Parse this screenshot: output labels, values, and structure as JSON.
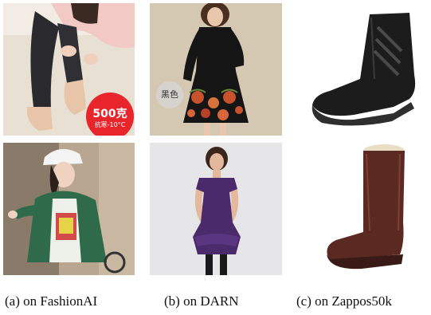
{
  "images": {
    "leggings": {
      "badge_weight": "500克",
      "badge_note": "抗寒-10°C"
    },
    "dress_black": {
      "badge_color": "黑色"
    }
  },
  "captions": {
    "a": "(a) on FashionAI",
    "b": "(b) on DARN",
    "c": "(c) on Zappos50k"
  },
  "colors": {
    "badge_red": "#e8252b",
    "leggings_black": "#2a2a2e",
    "dress_black": "#151515",
    "dress_purple": "#4a2a6a",
    "boot_black": "#1c1c1c",
    "boot_brown": "#5a2a22"
  }
}
